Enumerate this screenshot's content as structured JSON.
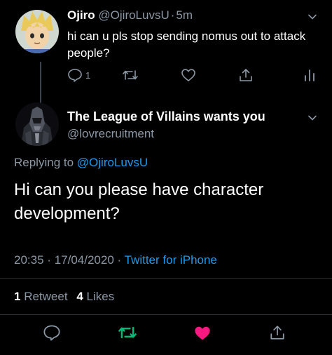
{
  "reply_tweet": {
    "display_name": "Ojiro",
    "handle": "@OjiroLuvsU",
    "separator": "·",
    "time": "5m",
    "text": "hi can u pls stop sending nomus out to attack people?",
    "reply_count": "1",
    "avatar_icon": "anime-boy-avatar",
    "accent_colors": {
      "hair": "#e8c95a",
      "skin": "#f2d3a8"
    }
  },
  "main_tweet": {
    "display_name": "The League of Villains wants you",
    "handle": "@lovrecruitment",
    "replying_prefix": "Replying to",
    "replying_to": "@OjiroLuvsU",
    "text": "Hi can you please have character development?",
    "time": "20:35",
    "meta_sep": "·",
    "date": "17/04/2020",
    "meta_sep2": "·",
    "source": "Twitter for iPhone",
    "retweet_count": "1",
    "retweet_label": "Retweet",
    "like_count": "4",
    "like_label": "Likes",
    "avatar_icon": "dark-villain-avatar"
  },
  "colors": {
    "background": "#000000",
    "link": "#1d9bf0",
    "muted": "#8b98a5",
    "retweet_active": "#00ba7c",
    "like_active": "#f91880"
  }
}
